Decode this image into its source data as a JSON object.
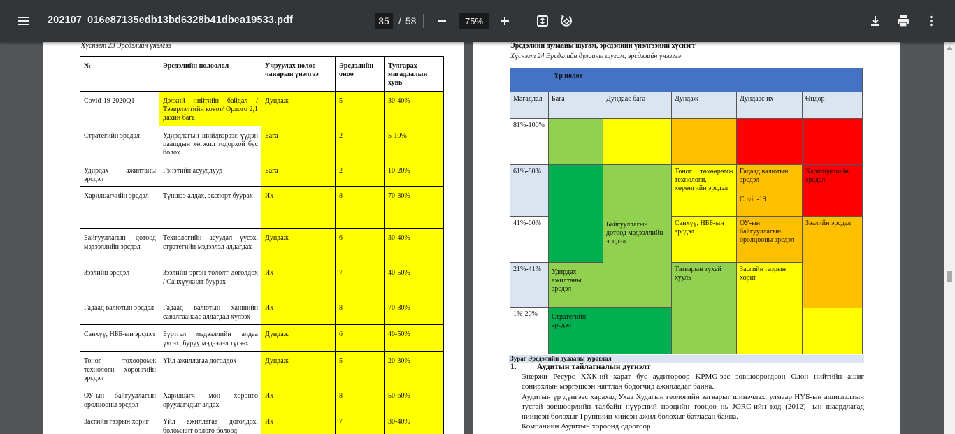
{
  "toolbar": {
    "title": "202107_016e87135edb13bd6328b41dbea19533.pdf",
    "page_current": "35",
    "page_sep": "/",
    "page_total": "58",
    "zoom": "75%",
    "icons": [
      "menu-icon",
      "minus-icon",
      "plus-icon",
      "fit-page-icon",
      "rotate-icon",
      "download-icon",
      "print-icon",
      "more-vert-icon"
    ]
  },
  "left_page": {
    "caption": "Хүснэгт 23 Эрсдэлийн үнэлгээ",
    "headers": [
      "№",
      "Эрсдэлийн нөлөөлөл",
      "Учруулах нөлөө чанарын үнэлгээ",
      "Эрсдэлийн оноо",
      "Тулгарах магадлалын хувь"
    ],
    "rows": [
      {
        "name": "Covid-19 2020Q1-",
        "impact": "Дэлхий нийтийн байдал /Тээврлэлтийн ковот/ Орлого 2,1 дахин бага",
        "quality": "Дундаж",
        "score": "5",
        "prob": "30-40%",
        "h": 50
      },
      {
        "name": "Стратегийн эрсдэл",
        "impact": "Удирдлагын шийдвэрээс үүдэн цаашдын хөгжил тодорхой бус болох",
        "quality": "Бага",
        "score": "2",
        "prob": "5-10%",
        "h": 50
      },
      {
        "name": "Удирдах ажилтаны эрсдэл",
        "impact": "Гэнэтийн асуудлууд",
        "quality": "Бага",
        "score": "2",
        "prob": "10-20%",
        "h": 35
      },
      {
        "name": "Харилцагчийн эрсдэл",
        "impact": "Түншээ алдах, экспорт буурах",
        "quality": "Их",
        "score": "8",
        "prob": "70-80%",
        "h": 60
      },
      {
        "name": "Байгууллагын дотоод мэдээллийн эрсдэл",
        "impact": "Технологийн асуудал үүсэх, стратегийн мэдээлэл алдагдах",
        "quality": "Дундаж",
        "score": "6",
        "prob": "30-40%",
        "h": 50
      },
      {
        "name": "Зээлийн эрсдэл",
        "impact": "Зээлийн эргэн төлөлт доголдох / Санхүүжилт буурах",
        "quality": "Их",
        "score": "7",
        "prob": "40-50%",
        "h": 50
      },
      {
        "name": "Гадаад валютын эрсдэл",
        "impact": "Гадаад валютын ханшийн савалгаанаас алдагдал хүлээх",
        "quality": "Их",
        "score": "8",
        "prob": "70-80%",
        "h": 38
      },
      {
        "name": "Санхүү, НББ-ын эрсдэл",
        "impact": "Бүртгэл мэдээллийн алдаа үүсэх, буруу мэдээлэл түгээх",
        "quality": "Дундаж",
        "score": "6",
        "prob": "40-50%",
        "h": 38
      },
      {
        "name": "Тоног төхөөрөмж технологи, хөрөнгийн эрсдэл",
        "impact": "Үйл ажиллагаа доголдох",
        "quality": "Дундаж",
        "score": "5",
        "prob": "20-30%",
        "h": 50
      },
      {
        "name": "ОУ-ын байгууллагын оролцооны эрсдэл",
        "impact": "Харилцагч мөн хөрөнгө оруулагчдыг алдах",
        "quality": "Их",
        "score": "8",
        "prob": "50-60%",
        "h": 37
      },
      {
        "name": "Засгийн газрын хориг",
        "impact": "Үйл ажиллагаа доголдох, боломжит орлого болоод",
        "quality": "Их",
        "score": "7",
        "prob": "30-40%",
        "h": 40
      }
    ]
  },
  "right_page": {
    "heading": "Эрсдэлийн дулааны шугам, эрсдэлийн үнэлгээний хүснэгт",
    "caption": "Хүснэгт 24 Эрсдэлийн дулааны шугам, эрсдэлийн үнэлгээ",
    "matrix": {
      "top_label": "Үр нөлөө",
      "row_header": "Магадлал",
      "columns": [
        "Бага",
        "Дундаас бага",
        "Дундаж",
        "Дундаас их",
        "Өндөр"
      ],
      "rows": [
        "81%-100%",
        "61%-80%",
        "41%-60%",
        "21%-41%",
        "1%-20%"
      ],
      "colors": {
        "header_blue": "#4472c4",
        "header_light": "#dbe5f1",
        "light_green": "#92d050",
        "dark_green": "#00b050",
        "yellow": "#ffff00",
        "orange": "#ffc000",
        "red": "#ff0000"
      },
      "labels": {
        "tonog": "Тоног төхөөрөмж технологи, хөрөнгийн эрсдэл",
        "gadaad": "Гадаад валютын эрсдэл",
        "covid": "Covid-19",
        "harilts": "Харилцагчийн эрсдэл",
        "baig": "Байгууллагын дотоод мэдээллийн эрсдэл",
        "sanhuu": "Санхүү, НББ-ын эрсдэл",
        "ou": "ОУ-ын байгууллагын оролцооны эрсдэл",
        "zeel": "Зээлийн эрсдэл",
        "udirdah": "Удирдах ажилтаны эрсдэл",
        "tatvar": "Татварын тухай хууль",
        "zasgiin": "Засгийн газрын хориг",
        "strateg": "Стратегийн эрсдэл"
      }
    },
    "figure_caption": "Зураг Эрсдэлийн дулааны зураглал",
    "section_num": "1.",
    "section_title": "Аудитын тайлагналын дүгнэлт",
    "paragraphs": [
      "Энержи Ресурс ХХК-ий харат бус аудитороор KPMG-ээс зөвшөөрөгдсөн Олон нийтийн ашиг сонирхлын мэргэшсэн нягтлан бодогчид ажилладаг байна..",
      "Аудитын үр дүнгээс харахад Ухаа Худагын геологийн загварыг шинэчлэх, улмаар НҮБ-ын ашиглалтын тусгай зөвшөөрлийн талбайн нүүрсний нөөцийн тооцоо нь JORC-ийн код (2012) -ын шаардлагад нийцсэн болохыг Группийн хийсэн ажил болохыг батласан байна.",
      "Компанийн Аудитын хороонд одоогоор"
    ]
  }
}
